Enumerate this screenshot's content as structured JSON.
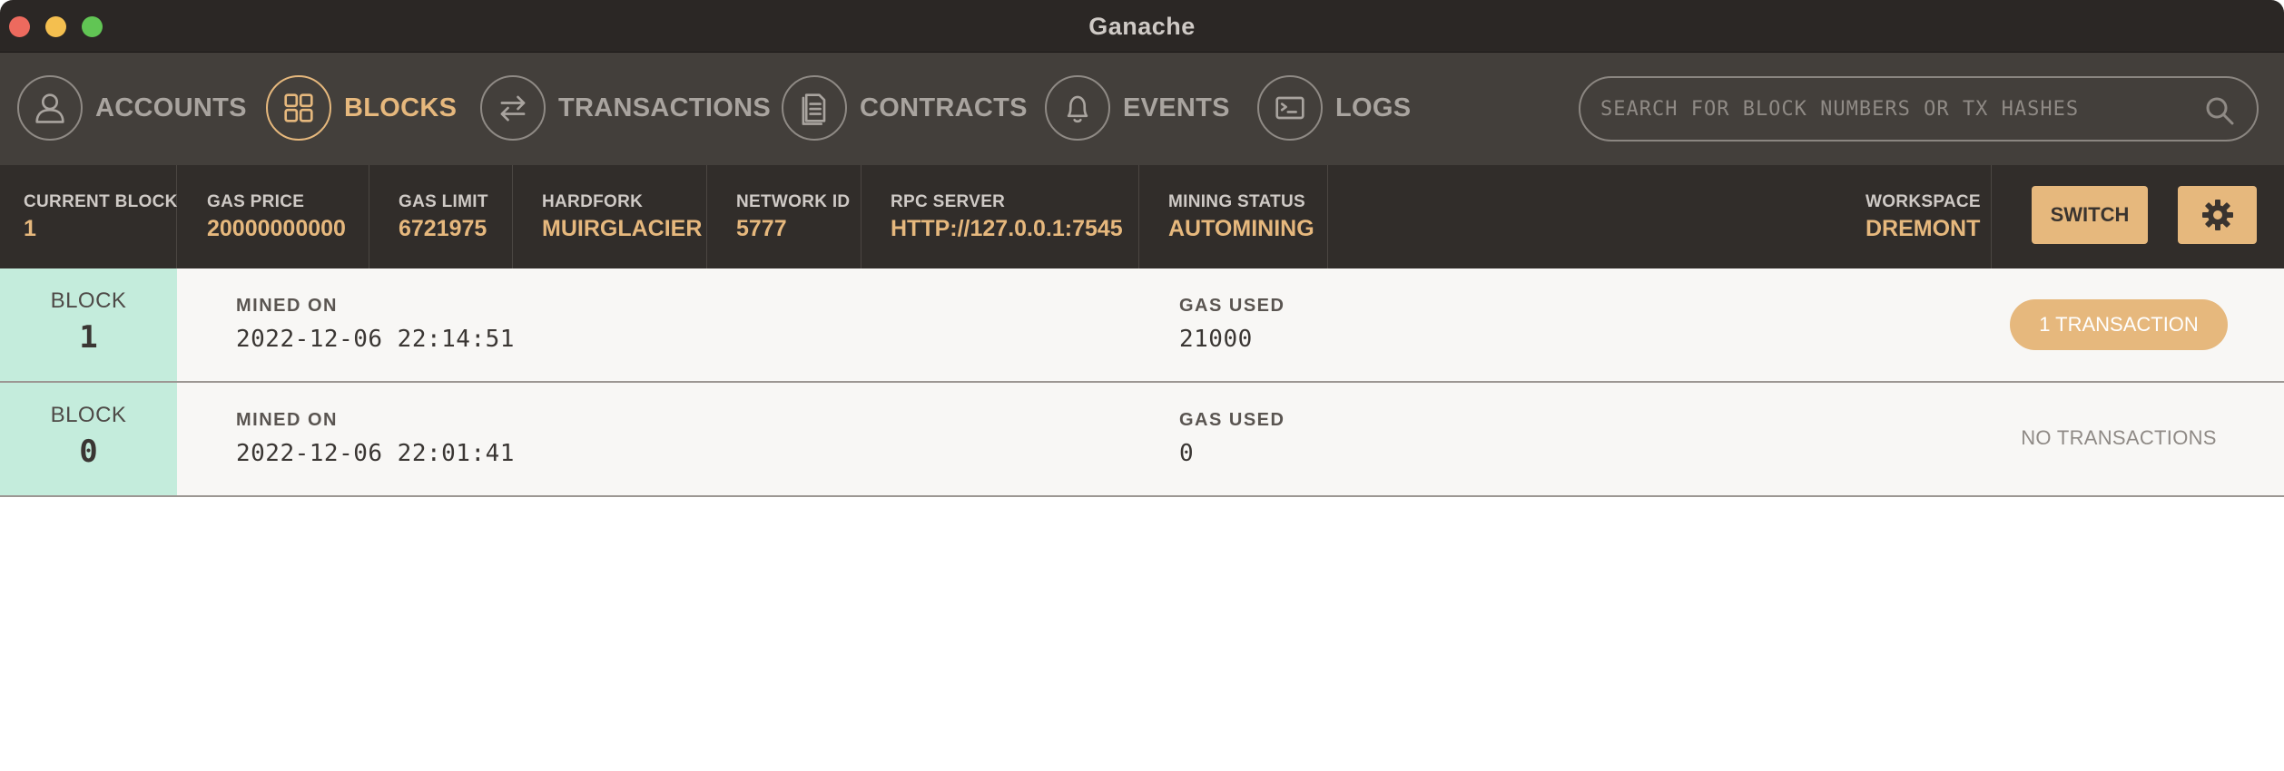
{
  "window": {
    "title": "Ganache"
  },
  "nav": {
    "items": [
      {
        "label": "ACCOUNTS",
        "icon": "user-icon",
        "active": false
      },
      {
        "label": "BLOCKS",
        "icon": "grid-icon",
        "active": true
      },
      {
        "label": "TRANSACTIONS",
        "icon": "arrows-swap-icon",
        "active": false
      },
      {
        "label": "CONTRACTS",
        "icon": "document-icon",
        "active": false
      },
      {
        "label": "EVENTS",
        "icon": "bell-icon",
        "active": false
      },
      {
        "label": "LOGS",
        "icon": "terminal-icon",
        "active": false
      }
    ],
    "search": {
      "placeholder": "SEARCH FOR BLOCK NUMBERS OR TX HASHES",
      "value": ""
    }
  },
  "status": {
    "current_block": {
      "label": "CURRENT BLOCK",
      "value": "1"
    },
    "gas_price": {
      "label": "GAS PRICE",
      "value": "20000000000"
    },
    "gas_limit": {
      "label": "GAS LIMIT",
      "value": "6721975"
    },
    "hardfork": {
      "label": "HARDFORK",
      "value": "MUIRGLACIER"
    },
    "network_id": {
      "label": "NETWORK ID",
      "value": "5777"
    },
    "rpc_server": {
      "label": "RPC SERVER",
      "value": "HTTP://127.0.0.1:7545"
    },
    "mining_status": {
      "label": "MINING STATUS",
      "value": "AUTOMINING"
    },
    "workspace": {
      "label": "WORKSPACE",
      "value": "DREMONT"
    },
    "switch_label": "SWITCH"
  },
  "blocks": [
    {
      "tag_label": "BLOCK",
      "number": "1",
      "mined_on_label": "MINED ON",
      "mined_on": "2022-12-06 22:14:51",
      "gas_used_label": "GAS USED",
      "gas_used": "21000",
      "transactions": "1 TRANSACTION"
    },
    {
      "tag_label": "BLOCK",
      "number": "0",
      "mined_on_label": "MINED ON",
      "mined_on": "2022-12-06 22:01:41",
      "gas_used_label": "GAS USED",
      "gas_used": "0",
      "transactions": "NO TRANSACTIONS"
    }
  ],
  "colors": {
    "accent": "#e6b87d",
    "titlebar": "#2b2725",
    "navbar": "#433f3b",
    "statusbar": "#312d2a",
    "block_tag": "#c4ecdc",
    "row_bg": "#f8f7f5"
  }
}
